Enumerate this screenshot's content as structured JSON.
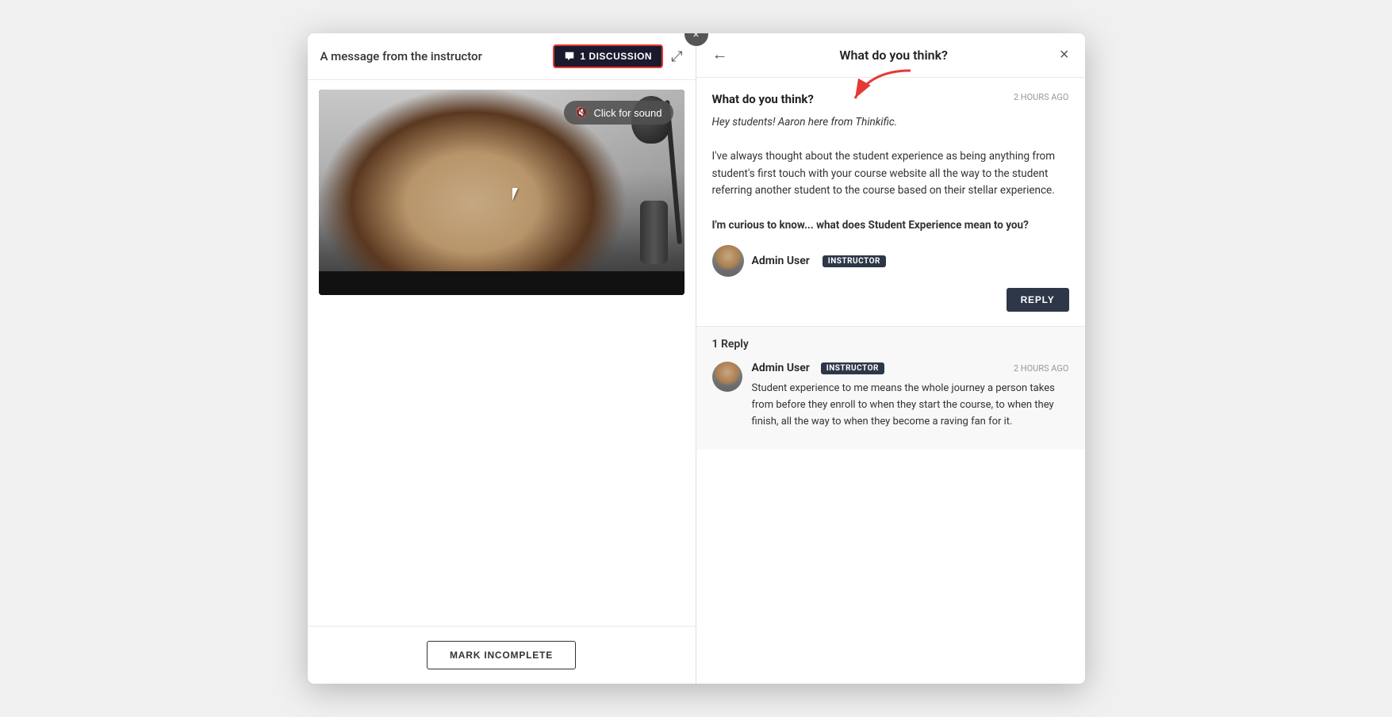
{
  "modal": {
    "close_label": "×",
    "left_panel": {
      "title": "A message from the instructor",
      "discussion_btn_label": "1 DISCUSSION",
      "expand_icon": "⤢",
      "sound_btn_label": "Click for sound",
      "mark_incomplete_label": "MARK INCOMPLETE"
    },
    "right_panel": {
      "back_icon": "←",
      "title": "What do you think?",
      "close_icon": "×",
      "post": {
        "topic_title": "What do you think?",
        "timestamp": "2 HOURS AGO",
        "body_italic": "Hey students! Aaron here from Thinkific.",
        "body_main": "I've always thought about the student experience as being anything from student's first touch with your course website all the way to the student referring another student to the course based on their stellar experience.",
        "body_question": "I'm curious to know... what does Student Experience mean to you?",
        "author_name": "Admin User",
        "author_badge": "INSTRUCTOR",
        "reply_btn_label": "REPLY"
      },
      "replies_section": {
        "replies_count": "1 Reply",
        "replies": [
          {
            "author_name": "Admin User",
            "author_badge": "INSTRUCTOR",
            "timestamp": "2 HOURS AGO",
            "body": "Student experience to me means the whole journey a person takes from before they enroll to when they start the course, to when they finish, all the way to when they become a raving fan for it."
          }
        ]
      }
    }
  }
}
